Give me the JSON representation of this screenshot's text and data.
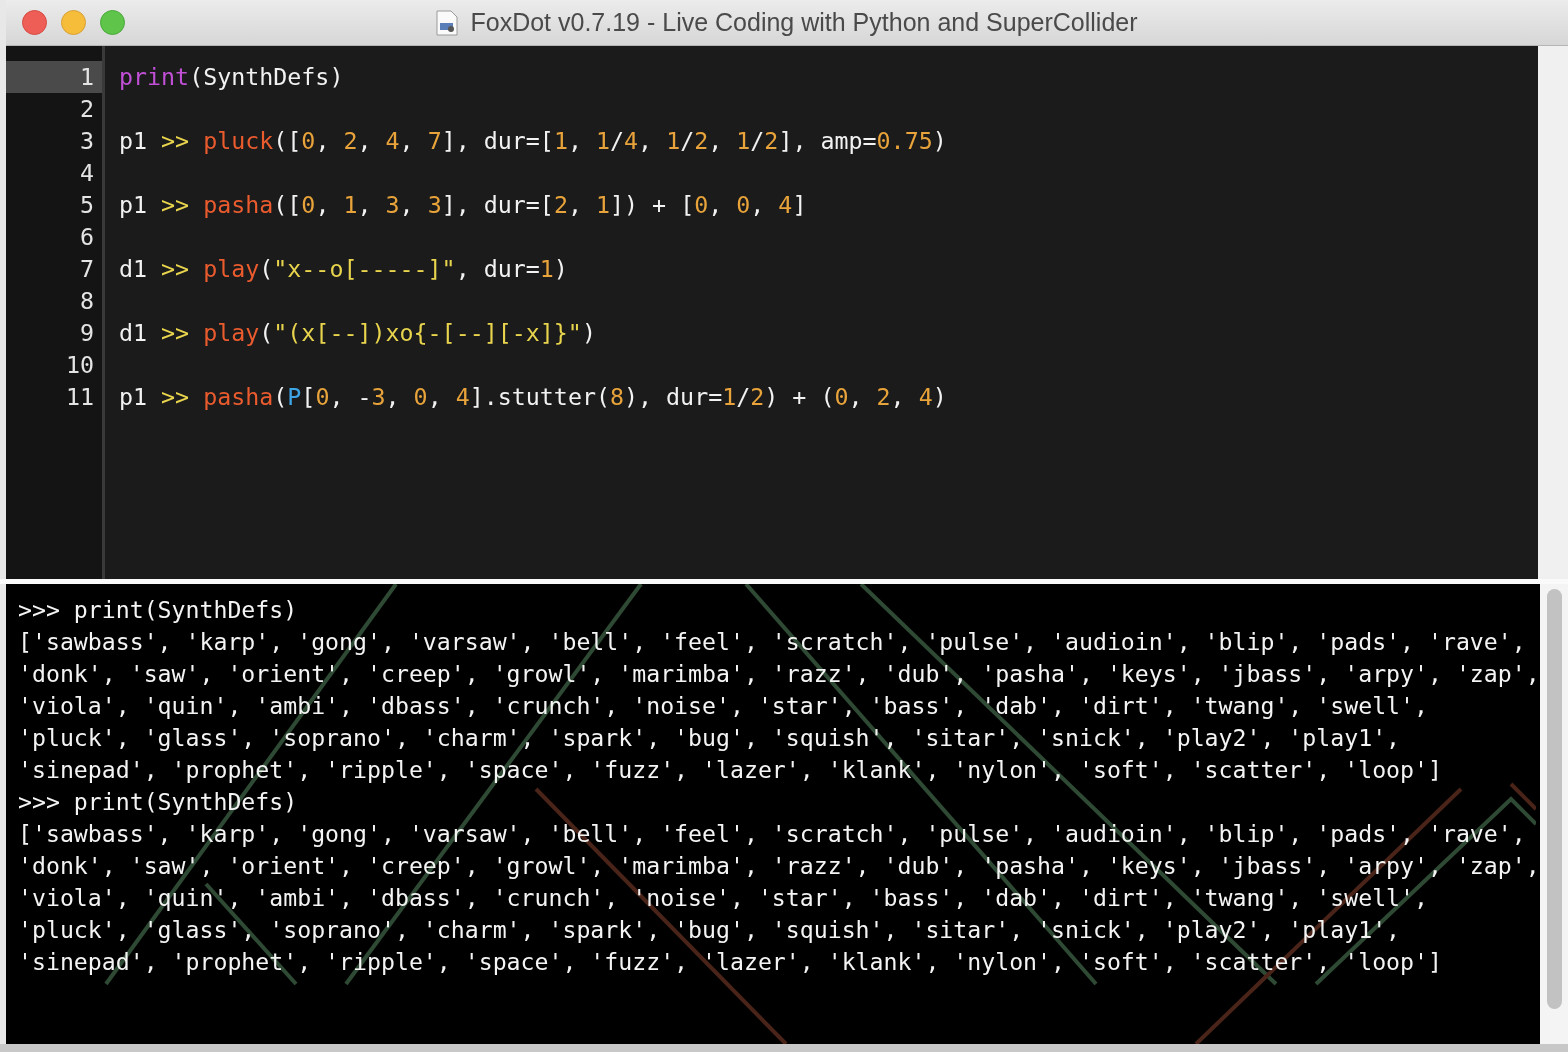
{
  "window": {
    "title": "FoxDot v0.7.19 - Live Coding with Python and SuperCollider"
  },
  "editor": {
    "lines": [
      {
        "number": "1",
        "current": true,
        "tokens": [
          {
            "kind": "builtin",
            "text": "print"
          },
          {
            "kind": "plain",
            "text": "(SynthDefs)"
          }
        ]
      },
      {
        "number": "2",
        "current": false
      },
      {
        "number": "3",
        "current": false,
        "tokens": [
          {
            "kind": "plain",
            "text": "p1 "
          },
          {
            "kind": "operator",
            "text": ">> "
          },
          {
            "kind": "function",
            "text": "pluck"
          },
          {
            "kind": "plain",
            "text": "(["
          },
          {
            "kind": "number",
            "text": "0"
          },
          {
            "kind": "plain",
            "text": ", "
          },
          {
            "kind": "number",
            "text": "2"
          },
          {
            "kind": "plain",
            "text": ", "
          },
          {
            "kind": "number",
            "text": "4"
          },
          {
            "kind": "plain",
            "text": ", "
          },
          {
            "kind": "number",
            "text": "7"
          },
          {
            "kind": "plain",
            "text": "], dur=["
          },
          {
            "kind": "number",
            "text": "1"
          },
          {
            "kind": "plain",
            "text": ", "
          },
          {
            "kind": "number",
            "text": "1"
          },
          {
            "kind": "plain",
            "text": "/"
          },
          {
            "kind": "number",
            "text": "4"
          },
          {
            "kind": "plain",
            "text": ", "
          },
          {
            "kind": "number",
            "text": "1"
          },
          {
            "kind": "plain",
            "text": "/"
          },
          {
            "kind": "number",
            "text": "2"
          },
          {
            "kind": "plain",
            "text": ", "
          },
          {
            "kind": "number",
            "text": "1"
          },
          {
            "kind": "plain",
            "text": "/"
          },
          {
            "kind": "number",
            "text": "2"
          },
          {
            "kind": "plain",
            "text": "], amp="
          },
          {
            "kind": "number",
            "text": "0.75"
          },
          {
            "kind": "plain",
            "text": ")"
          }
        ]
      },
      {
        "number": "4",
        "current": false
      },
      {
        "number": "5",
        "current": false,
        "tokens": [
          {
            "kind": "plain",
            "text": "p1 "
          },
          {
            "kind": "operator",
            "text": ">> "
          },
          {
            "kind": "function",
            "text": "pasha"
          },
          {
            "kind": "plain",
            "text": "(["
          },
          {
            "kind": "number",
            "text": "0"
          },
          {
            "kind": "plain",
            "text": ", "
          },
          {
            "kind": "number",
            "text": "1"
          },
          {
            "kind": "plain",
            "text": ", "
          },
          {
            "kind": "number",
            "text": "3"
          },
          {
            "kind": "plain",
            "text": ", "
          },
          {
            "kind": "number",
            "text": "3"
          },
          {
            "kind": "plain",
            "text": "], dur=["
          },
          {
            "kind": "number",
            "text": "2"
          },
          {
            "kind": "plain",
            "text": ", "
          },
          {
            "kind": "number",
            "text": "1"
          },
          {
            "kind": "plain",
            "text": "]) + ["
          },
          {
            "kind": "number",
            "text": "0"
          },
          {
            "kind": "plain",
            "text": ", "
          },
          {
            "kind": "number",
            "text": "0"
          },
          {
            "kind": "plain",
            "text": ", "
          },
          {
            "kind": "number",
            "text": "4"
          },
          {
            "kind": "plain",
            "text": "]"
          }
        ]
      },
      {
        "number": "6",
        "current": false
      },
      {
        "number": "7",
        "current": false,
        "tokens": [
          {
            "kind": "plain",
            "text": "d1 "
          },
          {
            "kind": "operator",
            "text": ">> "
          },
          {
            "kind": "function",
            "text": "play"
          },
          {
            "kind": "plain",
            "text": "("
          },
          {
            "kind": "string",
            "text": "\"x--o[-----]\""
          },
          {
            "kind": "plain",
            "text": ", dur="
          },
          {
            "kind": "number",
            "text": "1"
          },
          {
            "kind": "plain",
            "text": ")"
          }
        ]
      },
      {
        "number": "8",
        "current": false
      },
      {
        "number": "9",
        "current": false,
        "tokens": [
          {
            "kind": "plain",
            "text": "d1 "
          },
          {
            "kind": "operator",
            "text": ">> "
          },
          {
            "kind": "function",
            "text": "play"
          },
          {
            "kind": "plain",
            "text": "("
          },
          {
            "kind": "string",
            "text": "\"(x[--])xo{-[--][-x]}\""
          },
          {
            "kind": "plain",
            "text": ")"
          }
        ]
      },
      {
        "number": "10",
        "current": false
      },
      {
        "number": "11",
        "current": false,
        "tokens": [
          {
            "kind": "plain",
            "text": "p1 "
          },
          {
            "kind": "operator",
            "text": ">> "
          },
          {
            "kind": "function",
            "text": "pasha"
          },
          {
            "kind": "plain",
            "text": "("
          },
          {
            "kind": "class",
            "text": "P"
          },
          {
            "kind": "plain",
            "text": "["
          },
          {
            "kind": "number",
            "text": "0"
          },
          {
            "kind": "plain",
            "text": ", -"
          },
          {
            "kind": "number",
            "text": "3"
          },
          {
            "kind": "plain",
            "text": ", "
          },
          {
            "kind": "number",
            "text": "0"
          },
          {
            "kind": "plain",
            "text": ", "
          },
          {
            "kind": "number",
            "text": "4"
          },
          {
            "kind": "plain",
            "text": "].stutter("
          },
          {
            "kind": "number",
            "text": "8"
          },
          {
            "kind": "plain",
            "text": "), dur="
          },
          {
            "kind": "number",
            "text": "1"
          },
          {
            "kind": "plain",
            "text": "/"
          },
          {
            "kind": "number",
            "text": "2"
          },
          {
            "kind": "plain",
            "text": ") + ("
          },
          {
            "kind": "number",
            "text": "0"
          },
          {
            "kind": "plain",
            "text": ", "
          },
          {
            "kind": "number",
            "text": "2"
          },
          {
            "kind": "plain",
            "text": ", "
          },
          {
            "kind": "number",
            "text": "4"
          },
          {
            "kind": "plain",
            "text": ")"
          }
        ]
      }
    ]
  },
  "console": {
    "lines": [
      ">>> print(SynthDefs)",
      "['sawbass', 'karp', 'gong', 'varsaw', 'bell', 'feel', 'scratch', 'pulse', 'audioin', 'blip', 'pads', 'rave',",
      "'donk', 'saw', 'orient', 'creep', 'growl', 'marimba', 'razz', 'dub', 'pasha', 'keys', 'jbass', 'arpy', 'zap',",
      "'viola', 'quin', 'ambi', 'dbass', 'crunch', 'noise', 'star', 'bass', 'dab', 'dirt', 'twang', 'swell',",
      "'pluck', 'glass', 'soprano', 'charm', 'spark', 'bug', 'squish', 'sitar', 'snick', 'play2', 'play1',",
      "'sinepad', 'prophet', 'ripple', 'space', 'fuzz', 'lazer', 'klank', 'nylon', 'soft', 'scatter', 'loop']",
      ">>> print(SynthDefs)",
      "['sawbass', 'karp', 'gong', 'varsaw', 'bell', 'feel', 'scratch', 'pulse', 'audioin', 'blip', 'pads', 'rave',",
      "'donk', 'saw', 'orient', 'creep', 'growl', 'marimba', 'razz', 'dub', 'pasha', 'keys', 'jbass', 'arpy', 'zap',",
      "'viola', 'quin', 'ambi', 'dbass', 'crunch', 'noise', 'star', 'bass', 'dab', 'dirt', 'twang', 'swell',",
      "'pluck', 'glass', 'soprano', 'charm', 'spark', 'bug', 'squish', 'sitar', 'snick', 'play2', 'play1',",
      "'sinepad', 'prophet', 'ripple', 'space', 'fuzz', 'lazer', 'klank', 'nylon', 'soft', 'scatter', 'loop']"
    ]
  }
}
